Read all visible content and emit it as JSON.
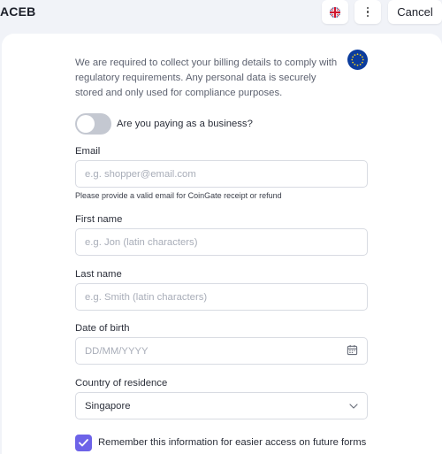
{
  "header": {
    "brand": "ACEB",
    "language_icon": "uk-flag-icon",
    "more_icon": "more-vertical-icon",
    "cancel_label": "Cancel"
  },
  "form": {
    "notice": "We are required to collect your billing details to comply with regulatory requirements. Any personal data is securely stored and only used for compliance purposes.",
    "badge_icon": "eu-flag-icon",
    "business_toggle": {
      "label": "Are you paying as a business?",
      "checked": false
    },
    "email": {
      "label": "Email",
      "placeholder": "e.g. shopper@email.com",
      "value": "",
      "hint": "Please provide a valid email for CoinGate receipt or refund"
    },
    "first_name": {
      "label": "First name",
      "placeholder": "e.g. Jon (latin characters)",
      "value": ""
    },
    "last_name": {
      "label": "Last name",
      "placeholder": "e.g. Smith (latin characters)",
      "value": ""
    },
    "dob": {
      "label": "Date of birth",
      "placeholder": "DD/MM/YYYY",
      "value": "",
      "icon": "calendar-icon"
    },
    "country": {
      "label": "Country of residence",
      "value": "Singapore",
      "icon": "chevron-down-icon"
    },
    "remember": {
      "label": "Remember this information for easier access on future forms",
      "checked": true
    }
  },
  "colors": {
    "accent": "#6d63e8",
    "page_bg": "#f1f3f8",
    "card_bg": "#ffffff",
    "eu_blue": "#0b3c9d",
    "eu_star": "#f5d21b"
  }
}
